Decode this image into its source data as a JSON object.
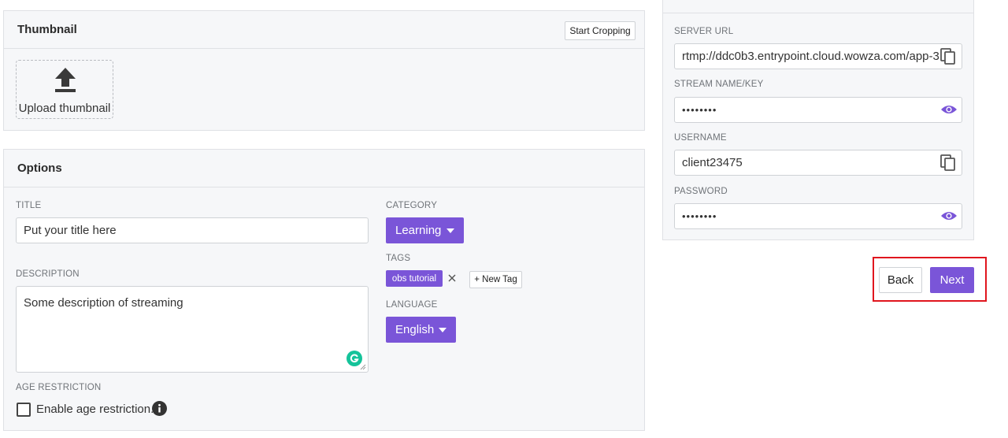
{
  "thumbnail": {
    "title": "Thumbnail",
    "start_cropping": "Start Cropping",
    "upload_label": "Upload thumbnail"
  },
  "options": {
    "title": "Options",
    "title_label": "TITLE",
    "title_placeholder": "Put your title here",
    "description_label": "DESCRIPTION",
    "description_value": "Some description of streaming",
    "age_label": "AGE RESTRICTION",
    "age_checkbox_label": "Enable age restriction.",
    "category_label": "CATEGORY",
    "category_value": "Learning",
    "tags_label": "TAGS",
    "tags": [
      "obs tutorial"
    ],
    "new_tag": "+ New Tag",
    "language_label": "LANGUAGE",
    "language_value": "English"
  },
  "stream": {
    "server_url_label": "SERVER URL",
    "server_url": "rtmp://ddc0b3.entrypoint.cloud.wowza.com/app-3",
    "stream_key_label": "STREAM NAME/KEY",
    "stream_key_masked": "••••••••",
    "username_label": "USERNAME",
    "username": "client23475",
    "password_label": "PASSWORD",
    "password_masked": "••••••••"
  },
  "nav": {
    "back": "Back",
    "next": "Next"
  },
  "colors": {
    "accent": "#7a55d8",
    "highlight": "#e0161e",
    "grammarly": "#15c39a"
  }
}
